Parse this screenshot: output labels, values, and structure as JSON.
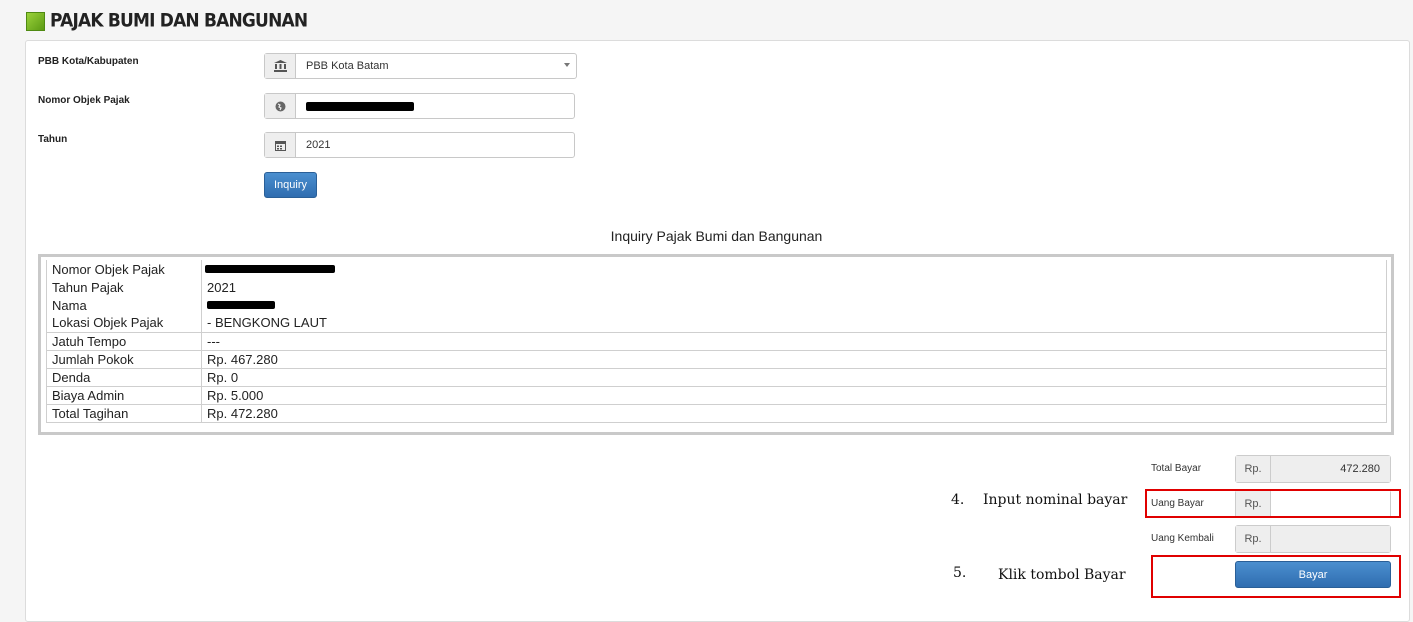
{
  "header": {
    "title": "PAJAK BUMI DAN BANGUNAN"
  },
  "form": {
    "kabupaten_label": "PBB Kota/Kabupaten",
    "kabupaten_value": "PBB Kota Batam",
    "nop_label": "Nomor Objek Pajak",
    "tahun_label": "Tahun",
    "tahun_value": "2021",
    "inquiry_button": "Inquiry"
  },
  "inquiry": {
    "title": "Inquiry Pajak Bumi dan Bangunan",
    "rows": [
      {
        "label": "Nomor Objek Pajak",
        "value": ""
      },
      {
        "label": "Tahun Pajak",
        "value": "2021"
      },
      {
        "label": "Nama",
        "value": ""
      },
      {
        "label": "Lokasi Objek Pajak",
        "value": "- BENGKONG LAUT"
      },
      {
        "label": "Jatuh Tempo",
        "value": "---"
      },
      {
        "label": "Jumlah Pokok",
        "value": "Rp. 467.280"
      },
      {
        "label": "Denda",
        "value": "Rp. 0"
      },
      {
        "label": "Biaya Admin",
        "value": "Rp. 5.000"
      },
      {
        "label": "Total Tagihan",
        "value": "Rp. 472.280"
      }
    ]
  },
  "summary": {
    "currency": "Rp.",
    "total_bayar_label": "Total Bayar",
    "total_bayar_value": "472.280",
    "uang_bayar_label": "Uang Bayar",
    "uang_bayar_value": "",
    "uang_kembali_label": "Uang Kembali",
    "uang_kembali_value": "",
    "bayar_button": "Bayar"
  },
  "annotations": {
    "step4_number": "4.",
    "step4_text": "Input nominal bayar",
    "step5_number": "5.",
    "step5_text": "Klik tombol Bayar",
    "highlight_color": "#e00000"
  },
  "icons": {
    "kabupaten": "institution-icon",
    "nop": "globe-icon",
    "tahun": "calendar-icon"
  }
}
